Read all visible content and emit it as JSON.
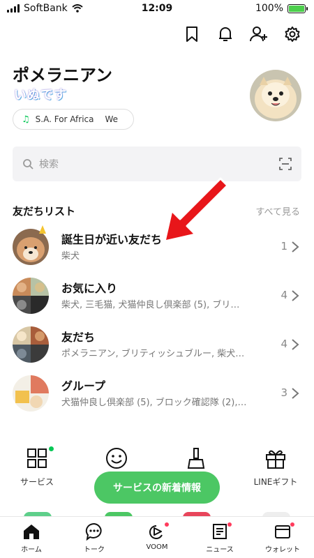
{
  "status_bar": {
    "carrier": "SoftBank",
    "time": "12:09",
    "battery": "100%",
    "battery_level": 1.0
  },
  "header": {
    "icons": [
      "bookmark-icon",
      "bell-icon",
      "add-friend-icon",
      "settings-icon"
    ]
  },
  "profile": {
    "name": "ポメラニアン",
    "status_message": "いぬです",
    "music": "S.A. For Africa",
    "music_extra": "We"
  },
  "search": {
    "placeholder": "検索"
  },
  "friends": {
    "section_title": "友だちリスト",
    "see_all": "すべて見る",
    "rows": [
      {
        "title": "誕生日が近い友だち",
        "subtitle": "柴犬",
        "count": "1"
      },
      {
        "title": "お気に入り",
        "subtitle": "柴犬, 三毛猫, 犬猫仲良し倶楽部 (5), ブリ…",
        "count": "4"
      },
      {
        "title": "友だち",
        "subtitle": "ポメラニアン, ブリティッシュブルー, 柴犬…",
        "count": "4"
      },
      {
        "title": "グループ",
        "subtitle": "犬猫仲良し倶楽部 (5), ブロック確認隊 (2),…",
        "count": "3"
      }
    ]
  },
  "services": [
    {
      "label": "サービス"
    },
    {
      "label": ""
    },
    {
      "label": ""
    },
    {
      "label": "LINEギフト"
    }
  ],
  "toast": "サービスの新着情報",
  "tabs": [
    {
      "label": "ホーム"
    },
    {
      "label": "トーク"
    },
    {
      "label": "VOOM"
    },
    {
      "label": "ニュース"
    },
    {
      "label": "ウォレット"
    }
  ],
  "colors": {
    "accent": "#06c755",
    "toast": "#4cc764",
    "badge": "#ff3b5c",
    "annotation_arrow": "#e8161a"
  }
}
